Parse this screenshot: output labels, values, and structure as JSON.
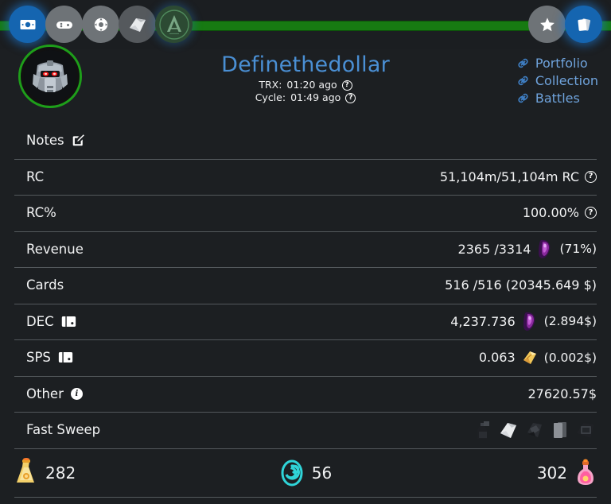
{
  "theme": {
    "bg": "#1c1f22",
    "accent_green": "#177a12",
    "accent_blue": "#1565b0",
    "link_blue": "#6fa3dc",
    "title_blue": "#4a8fd4",
    "divider": "#53585c",
    "text": "#f2f3f4"
  },
  "topnav": {
    "left_items": [
      {
        "name": "banknote-icon",
        "label": "Money",
        "active": true
      },
      {
        "name": "gamepad-icon",
        "label": "Games",
        "active": false
      },
      {
        "name": "soccer-ball-icon",
        "label": "Sports",
        "active": false
      },
      {
        "name": "card-packs-icon",
        "label": "Packs",
        "active": false
      },
      {
        "name": "archmage-logo-icon",
        "label": "A",
        "active": false
      }
    ],
    "right_items": [
      {
        "name": "star-icon",
        "label": "Favorites",
        "active": false
      },
      {
        "name": "cards-icon",
        "label": "Cards",
        "active": true
      }
    ]
  },
  "header": {
    "username": "Definethedollar",
    "avatar_name": "robot-avatar",
    "trx_label": "TRX:",
    "trx_value": "01:20 ago",
    "cycle_label": "Cycle:",
    "cycle_value": "01:49 ago",
    "help_glyph": "?",
    "links": [
      {
        "label": "Portfolio",
        "icon": "link-chain-icon"
      },
      {
        "label": "Collection",
        "icon": "link-chain-icon"
      },
      {
        "label": "Battles",
        "icon": "link-chain-icon"
      }
    ]
  },
  "rows": [
    {
      "id": "notes",
      "label": "Notes",
      "label_icon": "edit-pencil-icon",
      "value": ""
    },
    {
      "id": "rc",
      "label": "RC",
      "value": "51,104m/51,104m RC",
      "value_help": "?"
    },
    {
      "id": "rc-percent",
      "label": "RC%",
      "value": "100.00%",
      "value_help": "?"
    },
    {
      "id": "revenue",
      "label": "Revenue",
      "value": "2365 /3314",
      "value_icon": "dec-gem-icon",
      "value_suffix": "(71%)"
    },
    {
      "id": "cards",
      "label": "Cards",
      "value": "516 /516 (20345.649 $)"
    },
    {
      "id": "dec",
      "label": "DEC",
      "label_icon": "wallet-icon",
      "value": "4,237.736",
      "value_icon": "dec-gem-icon",
      "value_suffix": "(2.894$)"
    },
    {
      "id": "sps",
      "label": "SPS",
      "label_icon": "wallet-icon",
      "value": "0.063",
      "value_icon": "sps-scroll-icon",
      "value_suffix": "(0.002$)"
    },
    {
      "id": "other",
      "label": "Other",
      "label_icon": "info-circle-icon",
      "value": "27620.57$"
    },
    {
      "id": "fast-sweep",
      "label": "Fast Sweep",
      "sweep_icons": [
        "dark-bottle-icon",
        "white-pack-icon",
        "dark-crumple-icon",
        "gray-cards-icon",
        "dark-frame-icon"
      ]
    }
  ],
  "potion_bar": [
    {
      "id": "legendary-potion",
      "icon": "gold-potion-icon",
      "value": "282",
      "align": "left"
    },
    {
      "id": "energy-spiral",
      "icon": "teal-spiral-icon",
      "value": "56",
      "align": "mid"
    },
    {
      "id": "alchemy-potion",
      "icon": "pink-potion-icon",
      "value": "302",
      "align": "right"
    }
  ]
}
